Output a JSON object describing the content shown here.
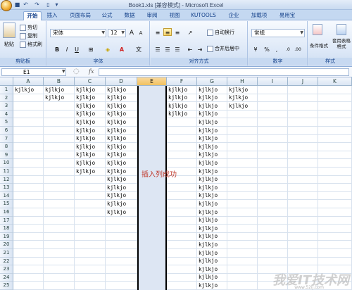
{
  "window": {
    "title": "Book1.xls  [兼容模式] - Microsoft Excel",
    "qat_icons": [
      "save-icon",
      "undo-icon",
      "redo-icon",
      "new-doc-icon",
      "qat-dropdown-icon"
    ]
  },
  "tabs": [
    "开始",
    "插入",
    "页面布局",
    "公式",
    "数据",
    "审阅",
    "视图",
    "KUTOOLS",
    "企业",
    "加载项",
    "易用宝"
  ],
  "active_tab": "开始",
  "ribbon": {
    "clipboard": {
      "label": "剪贴板",
      "paste": "粘贴",
      "cut": "剪切",
      "copy": "复制",
      "format_painter": "格式刷"
    },
    "font": {
      "label": "字体",
      "name": "宋体",
      "size": "12",
      "bold": "B",
      "italic": "I",
      "underline": "U"
    },
    "alignment": {
      "label": "对齐方式",
      "wrap_text": "自动换行",
      "merge_center": "合并后居中"
    },
    "number": {
      "label": "数字",
      "format": "常规"
    },
    "styles": {
      "conditional_formatting": "条件格式",
      "table_format": "套用表格格式",
      "label": "样式"
    }
  },
  "formula_bar": {
    "name_box": "E1",
    "fx": "fx",
    "value": ""
  },
  "columns": [
    "A",
    "B",
    "C",
    "D",
    "E",
    "F",
    "G",
    "H",
    "I",
    "J",
    "K"
  ],
  "selected_column": "E",
  "rows": [
    "1",
    "2",
    "3",
    "4",
    "5",
    "6",
    "7",
    "8",
    "9",
    "10",
    "11",
    "12",
    "13",
    "14",
    "15",
    "16",
    "17",
    "18",
    "19",
    "20",
    "21",
    "22",
    "23",
    "24",
    "25"
  ],
  "cell_text": "kjlkjo",
  "column_fill_rows": {
    "A": 1,
    "B": 2,
    "C": 11,
    "D": 16,
    "F": 4,
    "G": 28,
    "H": 3
  },
  "message": "插入列成功",
  "watermark": {
    "text": "我爱IT技术网",
    "url": "www.52ij.com"
  },
  "colors": {
    "selected_column_bg": "#dde6f3",
    "message_color": "#c0392b",
    "ribbon_text": "#15428b"
  }
}
